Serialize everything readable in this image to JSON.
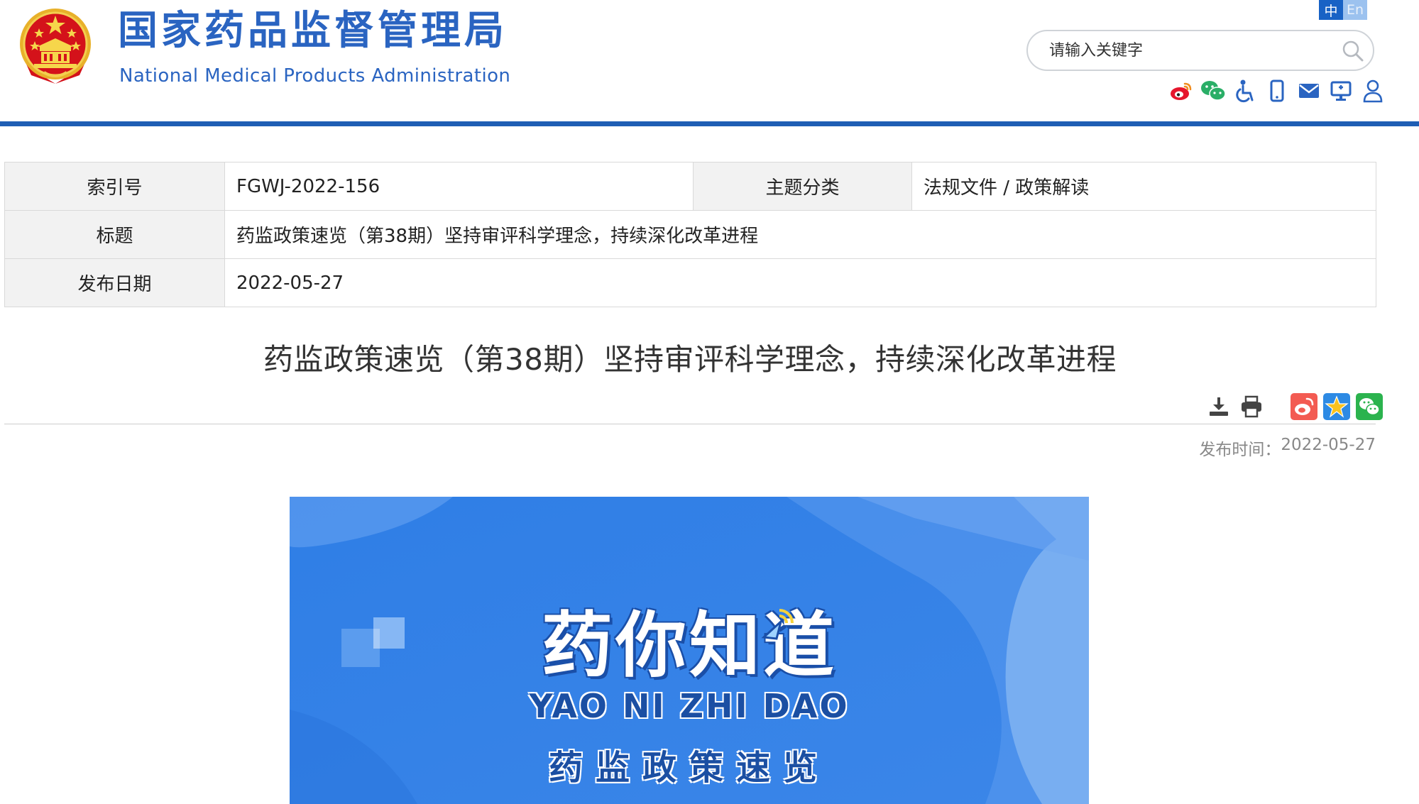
{
  "header": {
    "site_title": "国家药品监督管理局",
    "site_subtitle": "National Medical Products Administration",
    "emblem_icon": "national-emblem-icon",
    "lang": {
      "cn": "中",
      "en": "En"
    },
    "search": {
      "placeholder": "请输入关键字",
      "value": ""
    },
    "tool_icons": [
      "weibo-icon",
      "wechat-icon",
      "accessibility-icon",
      "mobile-icon",
      "mail-icon",
      "screen-reader-icon",
      "user-icon"
    ]
  },
  "meta": {
    "index_label": "索引号",
    "index_value": "FGWJ-2022-156",
    "category_label": "主题分类",
    "category_value": "法规文件 / 政策解读",
    "title_label": "标题",
    "title_value": "药监政策速览（第38期）坚持审评科学理念，持续深化改革进程",
    "date_label": "发布日期",
    "date_value": "2022-05-27"
  },
  "article": {
    "title": "药监政策速览（第38期）坚持审评科学理念，持续深化改革进程",
    "publish_label": "发布时间：",
    "publish_date": "2022-05-27",
    "action_icons": [
      "download-icon",
      "print-icon",
      "weibo-share-icon",
      "favorite-icon",
      "wechat-share-icon"
    ]
  },
  "banner": {
    "brand_cn": "药你知道",
    "brand_pinyin": "YAO NI ZHI DAO",
    "column_name": "药监政策速览"
  },
  "colors": {
    "brand_blue": "#2a64c1",
    "header_rule": "#1f5eb4",
    "banner_blue": "#3a85e6"
  }
}
